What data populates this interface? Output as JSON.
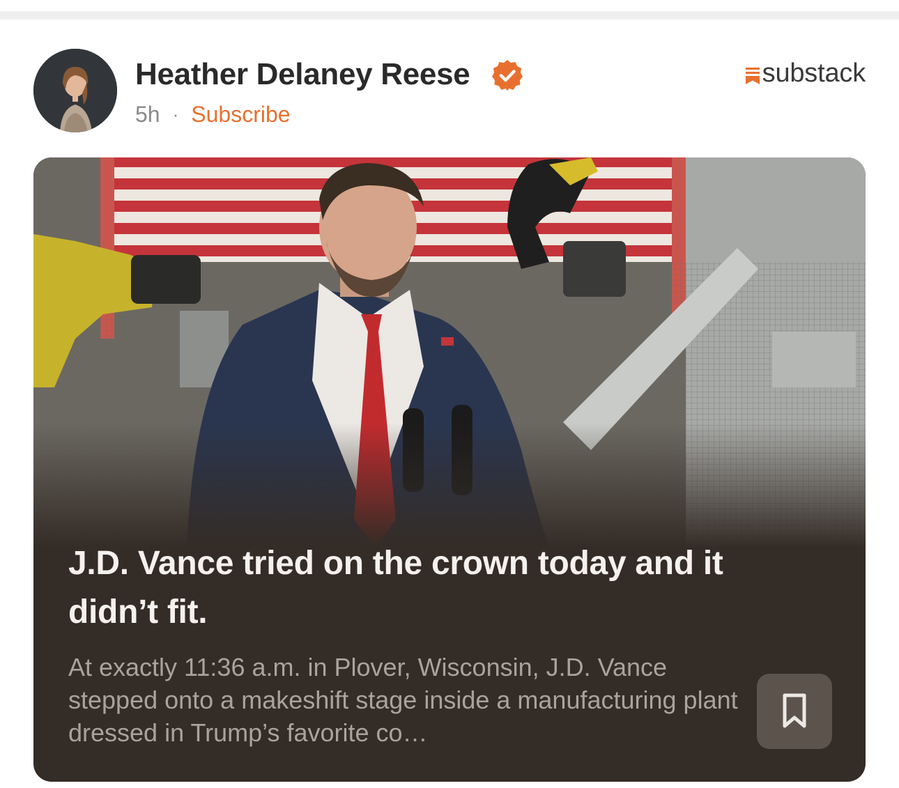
{
  "author": {
    "name": "Heather Delaney Reese",
    "verified": true,
    "time_ago": "5h",
    "separator": "·",
    "subscribe_label": "Subscribe"
  },
  "brand": {
    "name": "substack"
  },
  "post": {
    "title": "J.D. Vance tried on the crown today and it didn’t fit.",
    "excerpt": "At exactly 11:36 a.m. in Plover, Wisconsin, J.D. Vance stepped onto a makeshift stage inside a manufacturing plant dressed in Trump’s favorite co…",
    "bookmark_icon": "bookmark-icon"
  },
  "colors": {
    "accent": "#e8702f",
    "card_background": "#342c26",
    "title_text": "#f4f1ee",
    "excerpt_text": "#aaa39c",
    "bookmark_button": "#5c534c"
  }
}
